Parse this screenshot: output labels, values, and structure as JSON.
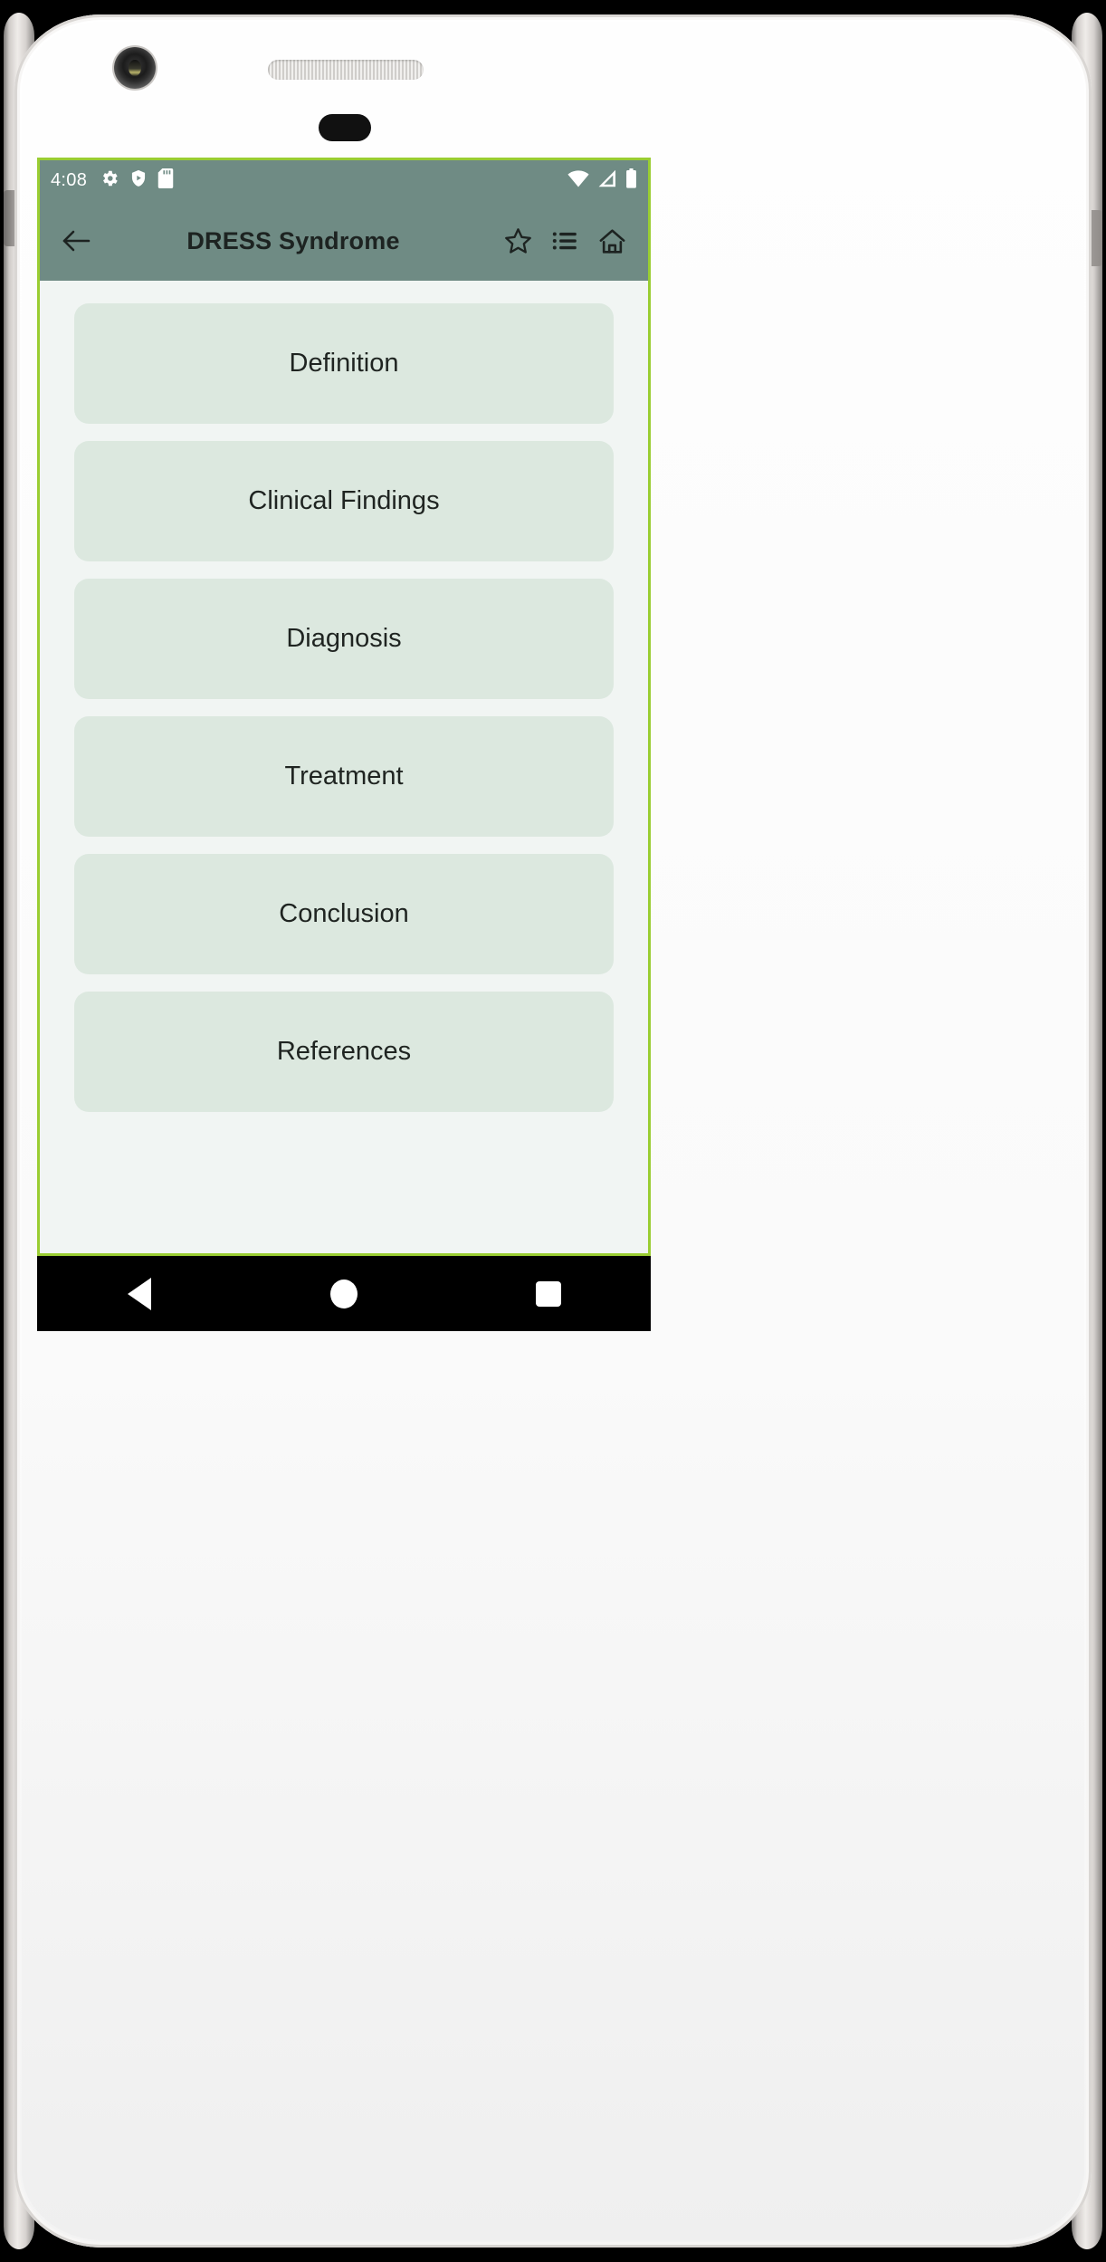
{
  "device": {
    "frame": "white-phone",
    "hardware": {
      "camera": "camera-icon",
      "speaker": "speaker-grille",
      "home_button": "home-button"
    }
  },
  "screen": {
    "border_color": "#9acd32",
    "background_color": "#f1f5f3"
  },
  "status_bar": {
    "background_color": "#6f8b84",
    "time": "4:08",
    "left_icons": [
      "settings-gear-icon",
      "play-protect-shield-icon",
      "sd-card-icon"
    ],
    "right_icons": [
      "wifi-icon",
      "cellular-signal-icon",
      "battery-icon"
    ]
  },
  "toolbar": {
    "background_color": "#6f8b84",
    "back_label": "Back",
    "title": "DRESS Syndrome",
    "actions": [
      {
        "name": "favorite",
        "icon": "star-outline-icon",
        "label": "Favorite"
      },
      {
        "name": "index",
        "icon": "list-icon",
        "label": "Index"
      },
      {
        "name": "home",
        "icon": "home-icon",
        "label": "Home"
      }
    ]
  },
  "content": {
    "button_color": "#dce8df",
    "text_color": "#1f2421",
    "menu": [
      {
        "label": "Definition"
      },
      {
        "label": "Clinical Findings"
      },
      {
        "label": "Diagnosis"
      },
      {
        "label": "Treatment"
      },
      {
        "label": "Conclusion"
      },
      {
        "label": "References"
      }
    ]
  },
  "nav_bar": {
    "background_color": "#000000",
    "buttons": [
      {
        "name": "back",
        "icon": "triangle-back-icon",
        "label": "Back"
      },
      {
        "name": "home",
        "icon": "circle-home-icon",
        "label": "Home"
      },
      {
        "name": "recents",
        "icon": "square-recents-icon",
        "label": "Recent apps"
      }
    ]
  }
}
